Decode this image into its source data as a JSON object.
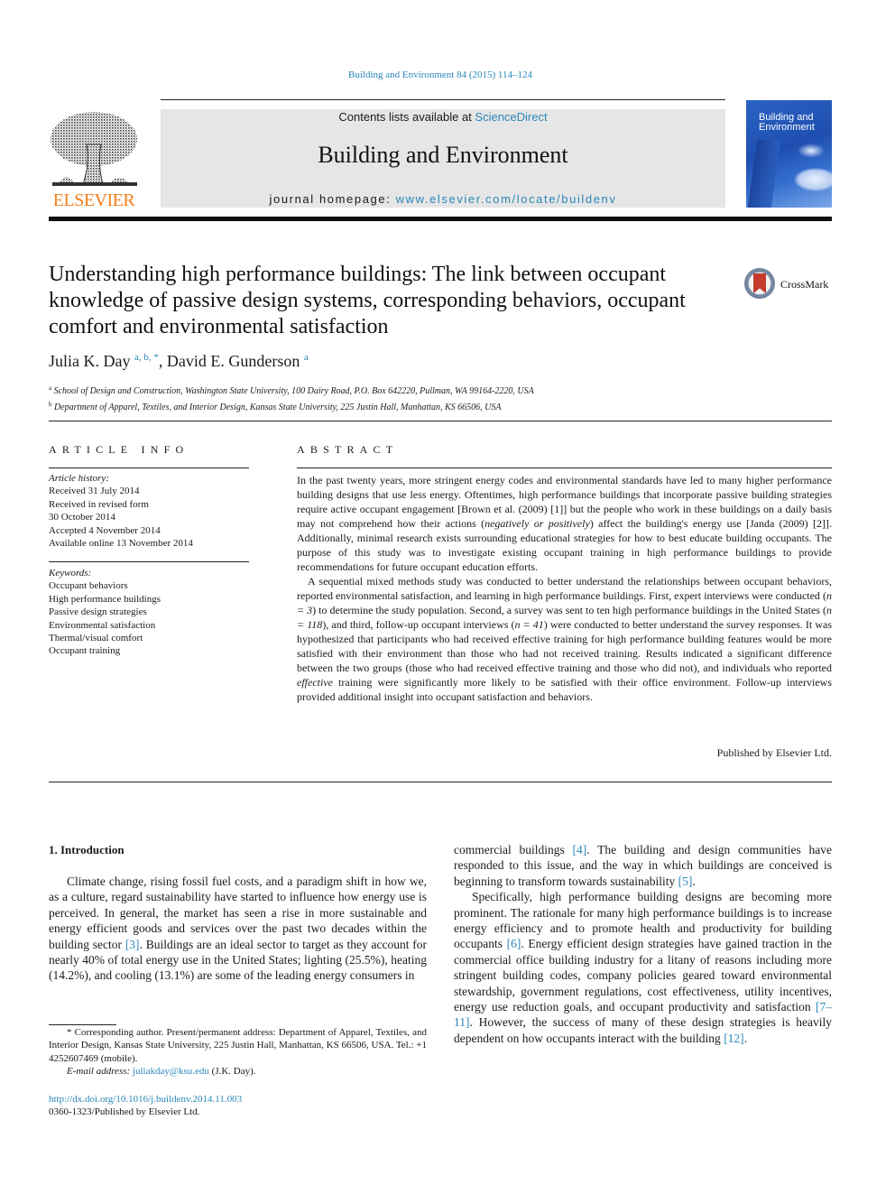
{
  "header": {
    "citation": "Building and Environment 84 (2015) 114–124",
    "publisher_logo_text": "ELSEVIER",
    "contents_prefix": "Contents lists available at ",
    "contents_link": "ScienceDirect",
    "journal_name": "Building and Environment",
    "homepage_prefix": "journal homepage: ",
    "homepage_url": "www.elsevier.com/locate/buildenv",
    "cover_title_line1": "Building and",
    "cover_title_line2": "Environment",
    "crossmark_label": "CrossMark"
  },
  "article": {
    "title": "Understanding high performance buildings: The link between occupant knowledge of passive design systems, corresponding behaviors, occupant comfort and environmental satisfaction",
    "authors": [
      {
        "name": "Julia K. Day",
        "sup": "a, b, *"
      },
      {
        "name": "David E. Gunderson",
        "sup": "a"
      }
    ],
    "author_separator": ", ",
    "affiliations": [
      {
        "mark": "a",
        "text": "School of Design and Construction, Washington State University, 100 Dairy Road, P.O. Box 642220, Pullman, WA 99164-2220, USA"
      },
      {
        "mark": "b",
        "text": "Department of Apparel, Textiles, and Interior Design, Kansas State University, 225 Justin Hall, Manhattan, KS 66506, USA"
      }
    ]
  },
  "article_info": {
    "heading": "ARTICLE INFO",
    "history_label": "Article history:",
    "history": [
      "Received 31 July 2014",
      "Received in revised form",
      "30 October 2014",
      "Accepted 4 November 2014",
      "Available online 13 November 2014"
    ],
    "keywords_label": "Keywords:",
    "keywords": [
      "Occupant behaviors",
      "High performance buildings",
      "Passive design strategies",
      "Environmental satisfaction",
      "Thermal/visual comfort",
      "Occupant training"
    ]
  },
  "abstract": {
    "heading": "ABSTRACT",
    "p1_a": "In the past twenty years, more stringent energy codes and environmental standards have led to many higher performance building designs that use less energy. Oftentimes, high performance buildings that incorporate passive building strategies require active occupant engagement [Brown et al. (2009) [1]] but the people who work in these buildings on a daily basis may not comprehend how their actions (",
    "p1_italic": "negatively or positively",
    "p1_b": ") affect the building's energy use [Janda (2009) [2]]. Additionally, minimal research exists surrounding educational strategies for how to best educate building occupants. The purpose of this study was to investigate existing occupant training in high performance buildings to provide recommendations for future occupant education efforts.",
    "p2_a": "A sequential mixed methods study was conducted to better understand the relationships between occupant behaviors, reported environmental satisfaction, and learning in high performance buildings. First, expert interviews were conducted (",
    "n1": "n = 3",
    "p2_b": ") to determine the study population. Second, a survey was sent to ten high performance buildings in the United States (",
    "n2": "n = 118",
    "p2_c": "), and third, follow-up occupant interviews (",
    "n3": "n = 41",
    "p2_d": ") were conducted to better understand the survey responses. It was hypothesized that participants who had received effective training for high performance building features would be more satisfied with their environment than those who had not received training. Results indicated a significant difference between the two groups (those who had received effective training and those who did not), and individuals who reported ",
    "p2_italic": "effective",
    "p2_e": " training were significantly more likely to be satisfied with their office environment. Follow-up interviews provided additional insight into occupant satisfaction and behaviors.",
    "published_by": "Published by Elsevier Ltd."
  },
  "introduction": {
    "heading": "1.  Introduction",
    "col1_a": "Climate change, rising fossil fuel costs, and a paradigm shift in how we, as a culture, regard sustainability have started to influence how energy use is perceived. In general, the market has seen a rise in more sustainable and energy efficient goods and services over the past two decades within the building sector ",
    "ref3": "[3]",
    "col1_b": ". Buildings are an ideal sector to target as they account for nearly 40% of total energy use in the United States; lighting (25.5%), heating (14.2%), and cooling (13.1%) are some of the leading energy consumers in",
    "col2_a": "commercial buildings ",
    "ref4": "[4]",
    "col2_b": ". The building and design communities have responded to this issue, and the way in which buildings are conceived is beginning to transform towards sustainability ",
    "ref5": "[5]",
    "col2_c": ".",
    "col2_p2_a": "Specifically, high performance building designs are becoming more prominent. The rationale for many high performance build­ings is to increase energy efficiency and to promote health and productivity for building occupants ",
    "ref6": "[6]",
    "col2_p2_b": ". Energy efficient design strategies have gained traction in the commercial office building industry for a litany of reasons including more stringent building codes, company policies geared toward environmental steward­ship, government regulations, cost effectiveness, utility incentives, energy use reduction goals, and occupant productivity and satis­faction ",
    "ref7_11": "[7–11]",
    "col2_p2_c": ". However, the success of many of these design strategies is heavily dependent on how occupants interact with the building ",
    "ref12": "[12]",
    "col2_p2_d": "."
  },
  "footnote": {
    "corresponding": "* Corresponding author. Present/permanent address: Department of Apparel, Textiles, and Interior Design, Kansas State University, 225 Justin Hall, Manhattan, KS 66506, USA. Tel.: +1 4252607469 (mobile).",
    "email_label": "E-mail address: ",
    "email": "juliakday@ksu.edu",
    "email_suffix": " (J.K. Day).",
    "doi": "http://dx.doi.org/10.1016/j.buildenv.2014.11.003",
    "issn": "0360-1323/Published by Elsevier Ltd."
  },
  "colors": {
    "link": "#2a87b8",
    "elsevier_orange": "#f07f1c",
    "masthead_bg": "#e6e6e6",
    "crossmark_red": "#c63a2b"
  }
}
